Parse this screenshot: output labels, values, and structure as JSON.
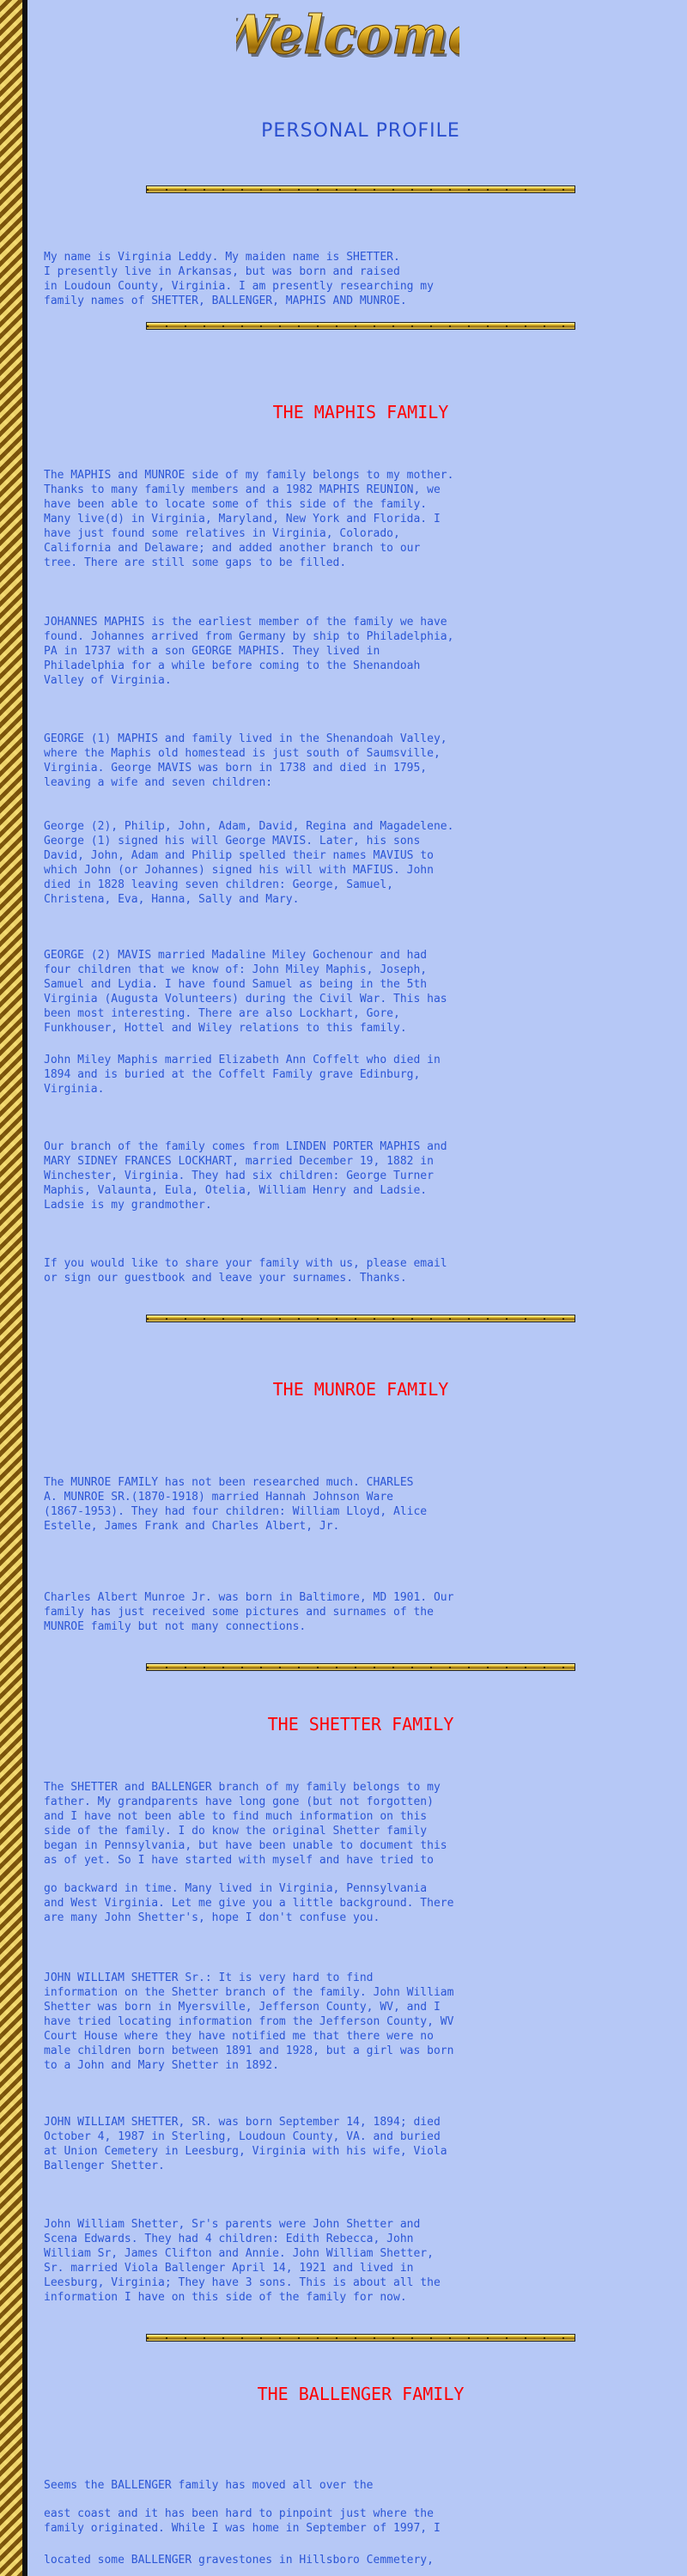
{
  "page": {
    "welcome_text": "Welcome",
    "profile_title": "PERSONAL PROFILE",
    "profile_para": "My name is Virginia Leddy. My maiden name is SHETTER.\nI presently live in Arkansas, but was born and raised\nin Loudoun County, Virginia. I am presently researching my\nfamily names of SHETTER, BALLENGER, MAPHIS AND MUNROE.",
    "colors": {
      "background": "#b6c8f6",
      "body_text": "#2b56d6",
      "section_title": "#ff0000",
      "profile_title": "#2a4fcf",
      "welcome_gold": "#e8b82a"
    }
  },
  "maphis": {
    "title": "THE MAPHIS FAMILY",
    "paragraphs": [
      "The MAPHIS and MUNROE side of my family belongs to my mother.\nThanks to many family members and a 1982 MAPHIS REUNION, we\nhave been able to locate some of this side of the family.\nMany live(d) in Virginia, Maryland, New York and Florida. I\nhave just found some relatives in Virginia, Colorado,\nCalifornia and Delaware; and added another branch to our\ntree. There are still some gaps to be filled.",
      "JOHANNES MAPHIS is the earliest member of the family we have\nfound. Johannes arrived from Germany by ship to Philadelphia,\nPA in 1737 with a son GEORGE MAPHIS. They lived in\nPhiladelphia for a while before coming to the Shenandoah\nValley of Virginia.",
      "GEORGE (1) MAPHIS and family lived in the Shenandoah Valley,\nwhere the Maphis old homestead is just south of Saumsville,\nVirginia.  George MAVIS was born in 1738 and died in 1795,\nleaving a wife and seven children:",
      "George (2), Philip, John, Adam, David, Regina and Magadelene.\nGeorge (1) signed his will George MAVIS.  Later, his sons\nDavid, John, Adam and Philip spelled their names MAVIUS to\nwhich John (or Johannes) signed his will with MAFIUS.  John\ndied in 1828 leaving seven children: George, Samuel,\nChristena, Eva, Hanna, Sally and Mary.",
      "GEORGE (2) MAVIS married Madaline Miley Gochenour and had\nfour children that we know of: John Miley Maphis, Joseph,\nSamuel and Lydia. I have found Samuel as being in the 5th\nVirginia (Augusta Volunteers) during the Civil War. This has\nbeen most interesting.  There are also Lockhart, Gore,\nFunkhouser, Hottel and Wiley relations to this family.",
      "John Miley Maphis married Elizabeth Ann Coffelt who died in\n1894 and is buried at the Coffelt Family grave Edinburg,\nVirginia.",
      "Our branch  of the family comes from LINDEN PORTER MAPHIS and\nMARY SIDNEY FRANCES LOCKHART, married December 19, 1882 in\nWinchester, Virginia.  They had six children: George Turner\nMaphis, Valaunta, Eula, Otelia, William Henry and Ladsie.\nLadsie is my grandmother.",
      "If you would like to share your family with us, please email\nor sign our guestbook and leave your surnames. Thanks."
    ]
  },
  "munroe": {
    "title": "THE MUNROE FAMILY",
    "paragraphs": [
      "The MUNROE FAMILY has not been researched much. CHARLES\nA. MUNROE SR.(1870-1918) married Hannah Johnson Ware\n(1867-1953). They had four children: William Lloyd, Alice\nEstelle, James Frank and Charles Albert, Jr.",
      "Charles Albert Munroe Jr. was born in Baltimore, MD 1901. Our\nfamily has just received some pictures and surnames of the\nMUNROE family but not many connections."
    ]
  },
  "shetter": {
    "title": "THE SHETTER FAMILY",
    "paragraphs": [
      "The SHETTER  and BALLENGER branch of my family belongs to my\nfather. My grandparents have long gone (but not forgotten)\nand I have not been able to find much information on this\nside of the family. I do know the original Shetter family\nbegan in Pennsylvania, but have been unable to document this\nas of yet. So I have started with myself and have tried to",
      " go backward in time.  Many lived in Virginia, Pennsylvania\nand West Virginia. Let me give you a little background. There\nare many John Shetter's, hope I don't confuse you.",
      "JOHN WILLIAM SHETTER Sr.:  It is very hard to find\ninformation on the Shetter branch of the family. John William\nShetter was born in Myersville, Jefferson County, WV, and I\nhave tried locating information from the Jefferson County, WV\nCourt House where they have notified me that there were no\nmale children born between 1891 and 1928, but a girl was born\nto a John and Mary Shetter in 1892.",
      "JOHN WILLIAM SHETTER, SR. was born September 14, 1894; died\nOctober 4, 1987 in Sterling, Loudoun County, VA. and buried\nat Union Cemetery in Leesburg, Virginia with his wife, Viola\nBallenger Shetter.",
      "John William Shetter, Sr's parents were John Shetter and\nScena Edwards.  They had 4 children: Edith Rebecca, John\nWilliam Sr, James Clifton and Annie.  John William Shetter,\nSr. married Viola Ballenger April 14, 1921 and lived in\nLeesburg, Virginia; They have 3 sons. This is about all the\ninformation I have on this side of the family for now."
    ]
  },
  "ballenger": {
    "title": "THE BALLENGER FAMILY",
    "paragraphs": [
      "Seems the BALLENGER family has moved all over the",
      "east coast and it has been hard to pinpoint just where the\nfamily originated. While I was home in September of 1997, I",
      "located some BALLENGER gravestones in Hillsboro Cemmetery,"
    ]
  }
}
